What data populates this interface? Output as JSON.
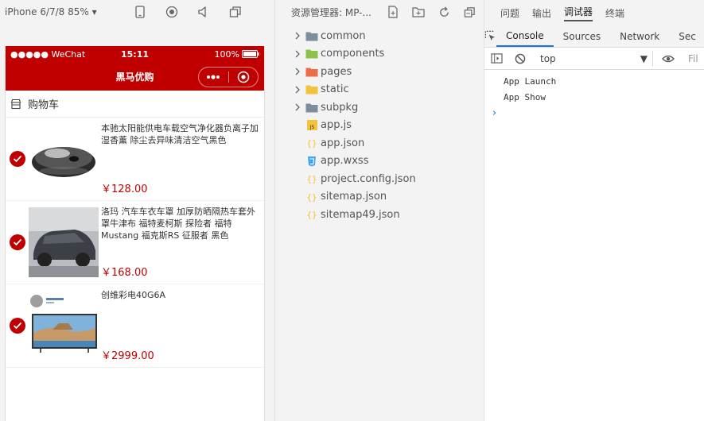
{
  "simulator": {
    "device_label": "iPhone 6/7/8 85% ▾",
    "status_bar": {
      "carrier": "●●●●● WeChat",
      "time": "15:11",
      "battery": "100%"
    },
    "navbar_title": "黑马优购",
    "cart_header": "购物车",
    "goods": [
      {
        "title": "本驰太阳能供电车载空气净化器负离子加湿香薰 除尘去异味清洁空气黑色",
        "price": "￥128.00",
        "checked": true,
        "image": "air-purifier"
      },
      {
        "title": "洛玛 汽车车衣车罩 加厚防晒隔热车套外罩牛津布 福特麦柯斯 探险者 福特Mustang 福克斯RS 征服者 黑色",
        "price": "￥168.00",
        "checked": true,
        "image": "car-cover"
      },
      {
        "title": "创维彩电40G6A",
        "price": "￥2999.00",
        "checked": true,
        "image": "tv"
      }
    ]
  },
  "explorer": {
    "title": "资源管理器: MP-...",
    "items": [
      {
        "name": "common",
        "type": "folder",
        "icon": "folder-icon",
        "color": "#7d8e9a"
      },
      {
        "name": "components",
        "type": "folder",
        "icon": "folder-components-icon",
        "color": "#8bc34a"
      },
      {
        "name": "pages",
        "type": "folder",
        "icon": "folder-pages-icon",
        "color": "#ef6c4a"
      },
      {
        "name": "static",
        "type": "folder",
        "icon": "folder-static-icon",
        "color": "#f5c33b"
      },
      {
        "name": "subpkg",
        "type": "folder",
        "icon": "folder-icon",
        "color": "#7d8e9a"
      },
      {
        "name": "app.js",
        "type": "file",
        "icon": "js-file-icon",
        "color": "#f5c33b"
      },
      {
        "name": "app.json",
        "type": "file",
        "icon": "json-file-icon",
        "color": "#f5c33b"
      },
      {
        "name": "app.wxss",
        "type": "file",
        "icon": "wxss-file-icon",
        "color": "#42a5f5"
      },
      {
        "name": "project.config.json",
        "type": "file",
        "icon": "json-file-icon",
        "color": "#f5c33b"
      },
      {
        "name": "sitemap.json",
        "type": "file",
        "icon": "json-file-icon",
        "color": "#f5c33b"
      },
      {
        "name": "sitemap49.json",
        "type": "file",
        "icon": "json-file-icon",
        "color": "#f5c33b"
      }
    ]
  },
  "devtools": {
    "top_tabs": [
      "问题",
      "输出",
      "调试器",
      "终端"
    ],
    "active_top_tab": "调试器",
    "tabs": [
      "Console",
      "Sources",
      "Network",
      "Sec"
    ],
    "active_tab": "Console",
    "context": "top",
    "filter_placeholder": "Fil",
    "console_lines": [
      "App  Launch",
      "App  Show"
    ],
    "prompt": "›"
  },
  "colors": {
    "brand": "#c00000",
    "accent": "#1a73e8"
  }
}
